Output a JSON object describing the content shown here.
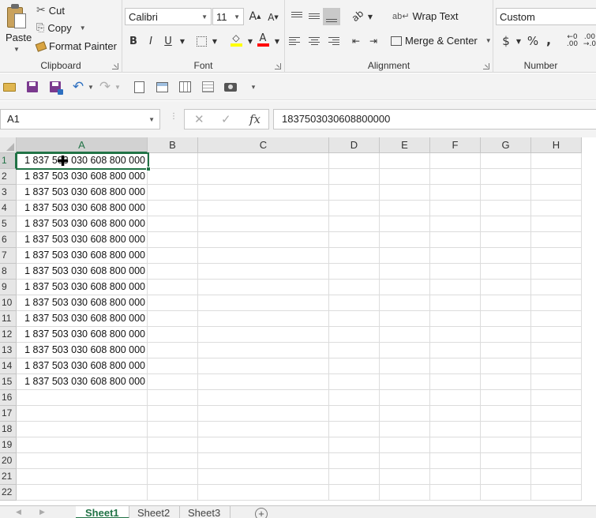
{
  "ribbon": {
    "clipboard": {
      "label": "Clipboard",
      "paste": "Paste",
      "cut": "Cut",
      "copy": "Copy",
      "format_painter": "Format Painter"
    },
    "font": {
      "label": "Font",
      "font_name": "Calibri",
      "font_size": "11"
    },
    "alignment": {
      "label": "Alignment",
      "wrap_text": "Wrap Text",
      "merge_center": "Merge & Center"
    },
    "number": {
      "label": "Number",
      "format": "Custom"
    }
  },
  "formula_bar": {
    "name_box": "A1",
    "formula": "1837503030608800000"
  },
  "columns": [
    "A",
    "B",
    "C",
    "D",
    "E",
    "F",
    "G",
    "H"
  ],
  "rows": [
    "1",
    "2",
    "3",
    "4",
    "5",
    "6",
    "7",
    "8",
    "9",
    "10",
    "11",
    "12",
    "13",
    "14",
    "15",
    "16",
    "17",
    "18",
    "19",
    "20",
    "21",
    "22"
  ],
  "cell_values": [
    "1 837 503 030 608 800 000",
    "1 837 503 030 608 800 000",
    "1 837 503 030 608 800 000",
    "1 837 503 030 608 800 000",
    "1 837 503 030 608 800 000",
    "1 837 503 030 608 800 000",
    "1 837 503 030 608 800 000",
    "1 837 503 030 608 800 000",
    "1 837 503 030 608 800 000",
    "1 837 503 030 608 800 000",
    "1 837 503 030 608 800 000",
    "1 837 503 030 608 800 000",
    "1 837 503 030 608 800 000",
    "1 837 503 030 608 800 000",
    "1 837 503 030 608 800 000"
  ],
  "sheets": [
    "Sheet1",
    "Sheet2",
    "Sheet3"
  ],
  "active_sheet": "Sheet1",
  "colors": {
    "accent": "#217346",
    "font_color": "#ff0000",
    "highlight": "#ffff00"
  }
}
